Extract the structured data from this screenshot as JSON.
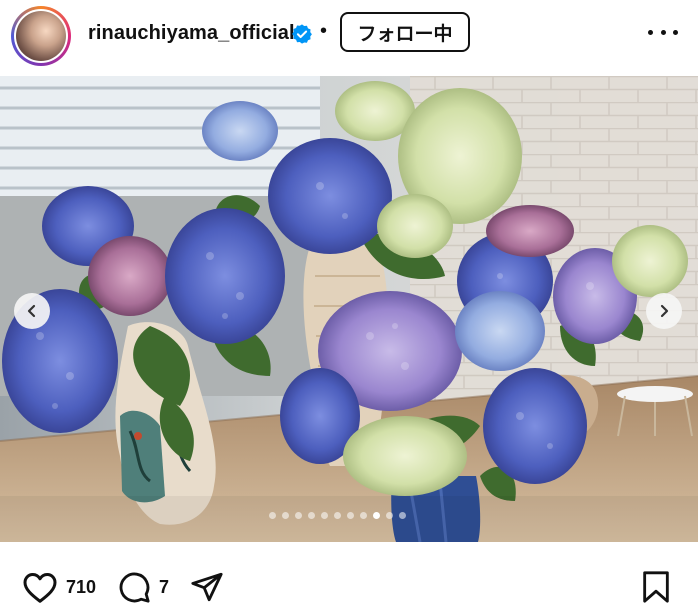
{
  "header": {
    "username": "rinauchiyama_official",
    "separator": "•",
    "follow_label": "フォロー中"
  },
  "carousel": {
    "slide_count": 11,
    "active_index": 8
  },
  "actions": {
    "likes": "710",
    "comments": "7"
  },
  "colors": {
    "verified": "#0095f6",
    "text": "#111111",
    "hydrangea_blue": "#5a6fc8",
    "hydrangea_purple": "#8b7ac4",
    "hydrangea_white": "#d9e6b8"
  },
  "icons": {
    "verified": "verified-badge-icon",
    "more": "more-options-icon",
    "prev": "chevron-left-icon",
    "next": "chevron-right-icon",
    "like": "heart-icon",
    "comment": "comment-bubble-icon",
    "share": "paper-plane-icon",
    "save": "bookmark-icon"
  }
}
